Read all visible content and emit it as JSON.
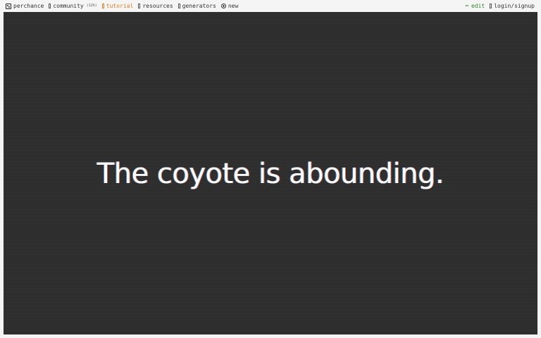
{
  "nav": {
    "left": [
      {
        "label": "perchance",
        "icon": "dice-icon"
      },
      {
        "label": "community",
        "count": "(12h)",
        "icon": "box-icon"
      },
      {
        "label": "tutorial",
        "icon": "box-icon"
      },
      {
        "label": "resources",
        "icon": "box-icon"
      },
      {
        "label": "generators",
        "icon": "box-icon"
      },
      {
        "label": "new",
        "icon": "plus-circle-icon"
      }
    ],
    "right": [
      {
        "label": "edit",
        "icon": "pencil-icon"
      },
      {
        "label": "login/signup",
        "icon": "box-icon"
      }
    ]
  },
  "main": {
    "text": "The coyote is abounding."
  },
  "colors": {
    "tutorial": "#e07b1f",
    "edit": "#2e8b2e",
    "stage_background": "#2d2d2d",
    "text": "#ffffff"
  }
}
